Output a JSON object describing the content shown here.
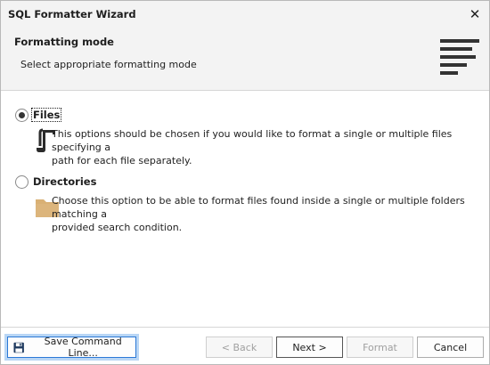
{
  "window": {
    "title": "SQL Formatter Wizard",
    "close_symbol": "✕"
  },
  "header": {
    "title": "Formatting mode",
    "subtitle": "Select appropriate formatting mode",
    "icon": "format-lines-icon"
  },
  "options": [
    {
      "label": "Files",
      "selected": true,
      "description_line1": "This options should be chosen if you would like to format a single or multiple files specifying a",
      "description_line2": "path for each file separately.",
      "icon": "file-script-icon"
    },
    {
      "label": "Directories",
      "selected": false,
      "description_line1": "Choose this option to be able to format files found inside a single or multiple folders matching a",
      "description_line2": "provided search condition.",
      "icon": "folder-icon"
    }
  ],
  "buttons": {
    "save": "Save Command Line...",
    "back": "< Back",
    "next": "Next >",
    "format": "Format",
    "cancel": "Cancel"
  },
  "colors": {
    "folder": "#d9b074",
    "focus": "#2b79d6"
  }
}
